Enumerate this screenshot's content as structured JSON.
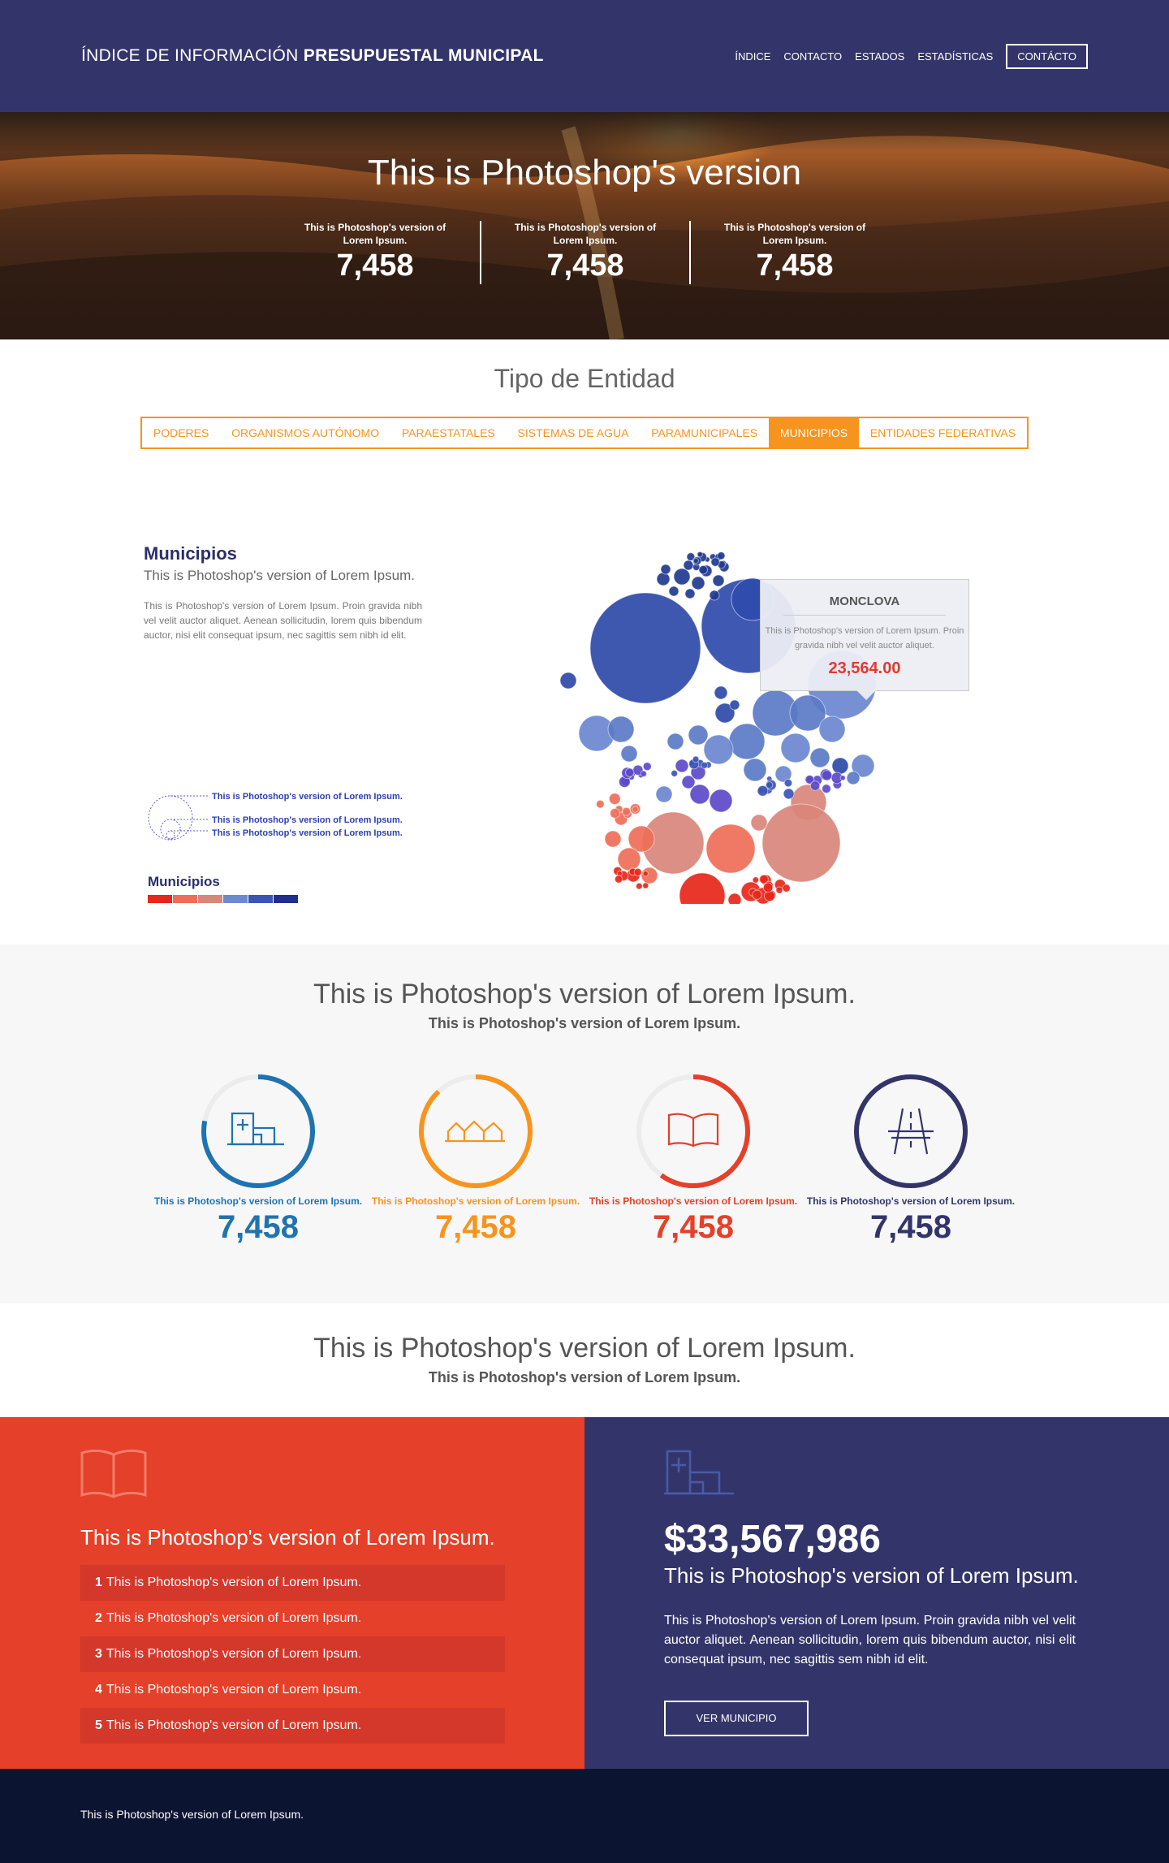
{
  "header": {
    "brand_light": "ÍNDICE DE INFORMACIÓN",
    "brand_bold": "PRESUPUESTAL MUNICIPAL",
    "nav": [
      {
        "label": "ÍNDICE"
      },
      {
        "label": "CONTACTO"
      },
      {
        "label": "ESTADOS"
      },
      {
        "label": "ESTADÍSTICAS"
      }
    ],
    "nav_button": "CONTÁCTO"
  },
  "hero": {
    "title": "This is Photoshop's version",
    "stats": [
      {
        "label": "This is Photoshop's version of Lorem Ipsum.",
        "value": "7,458"
      },
      {
        "label": "This is Photoshop's version of Lorem Ipsum.",
        "value": "7,458"
      },
      {
        "label": "This is Photoshop's version of Lorem Ipsum.",
        "value": "7,458"
      }
    ]
  },
  "entity": {
    "title": "Tipo de Entidad",
    "tabs": [
      "PODERES",
      "ORGANISMOS AUTÓNOMO",
      "PARAESTATALES",
      "SISTEMAS DE AGUA",
      "PARAMUNICIPALES",
      "MUNICIPIOS",
      "ENTIDADES FEDERATIVAS"
    ],
    "active_tab": "MUNICIPIOS"
  },
  "municipios": {
    "title": "Municipios",
    "subtitle": "This is Photoshop's version of Lorem Ipsum.",
    "description": "This is Photoshop's version  of Lorem Ipsum. Proin gravida nibh vel velit auctor aliquet. Aenean sollicitudin, lorem quis bibendum auctor, nisi elit consequat ipsum, nec sagittis sem nibh id elit.",
    "size_legend": [
      "This is Photoshop's version of Lorem Ipsum.",
      "This is Photoshop's version of Lorem Ipsum.",
      "This is Photoshop's version of Lorem Ipsum."
    ],
    "color_legend_title": "Municipios",
    "color_legend_colors": [
      "#e8261a",
      "#ee6e58",
      "#d9867a",
      "#6c8ad4",
      "#3a55b5",
      "#1f2f8e"
    ],
    "tooltip": {
      "name": "MONCLOVA",
      "description": "This is Photoshop's version  of Lorem Ipsum. Proin gravida nibh vel velit auctor aliquet.",
      "value": "23,564.00"
    }
  },
  "stats": {
    "title": "This is Photoshop's version of Lorem Ipsum.",
    "subtitle": "This is Photoshop's version of Lorem Ipsum.",
    "items": [
      {
        "icon": "hospital-icon",
        "color": "#1f73b0",
        "progress": 0.78,
        "label": "This is Photoshop's version of Lorem Ipsum.",
        "value": "7,458"
      },
      {
        "icon": "houses-icon",
        "color": "#f7941d",
        "progress": 0.88,
        "label": "This is Photoshop's version of Lorem Ipsum.",
        "value": "7,458"
      },
      {
        "icon": "book-icon",
        "color": "#e4402a",
        "progress": 0.6,
        "label": "This is Photoshop's version of Lorem Ipsum.",
        "value": "7,458"
      },
      {
        "icon": "road-icon",
        "color": "#33356a",
        "progress": 1.0,
        "label": "This is Photoshop's version of Lorem Ipsum.",
        "value": "7,458"
      }
    ]
  },
  "section2": {
    "title": "This is Photoshop's version of Lorem Ipsum.",
    "subtitle": "This is Photoshop's version of Lorem Ipsum."
  },
  "panel_red": {
    "icon": "book-icon",
    "title": "This is Photoshop's version of Lorem Ipsum.",
    "items": [
      {
        "rank": "1",
        "text": "This is Photoshop's version of Lorem Ipsum."
      },
      {
        "rank": "2",
        "text": "This is Photoshop's version of Lorem Ipsum."
      },
      {
        "rank": "3",
        "text": "This is Photoshop's version of Lorem Ipsum."
      },
      {
        "rank": "4",
        "text": "This is Photoshop's version of Lorem Ipsum."
      },
      {
        "rank": "5",
        "text": "This is Photoshop's version of Lorem Ipsum."
      }
    ]
  },
  "panel_blue": {
    "icon": "hospital-icon",
    "amount": "$33,567,986",
    "tagline": "This is Photoshop's version of Lorem Ipsum.",
    "paragraph": "This is Photoshop's version  of Lorem Ipsum. Proin gravida nibh vel velit auctor aliquet. Aenean sollicitudin, lorem quis bibendum auctor, nisi elit consequat ipsum, nec sagittis sem nibh id elit.",
    "button": "VER MUNICIPIO"
  },
  "footer": {
    "text": "This is Photoshop's version of Lorem Ipsum."
  }
}
